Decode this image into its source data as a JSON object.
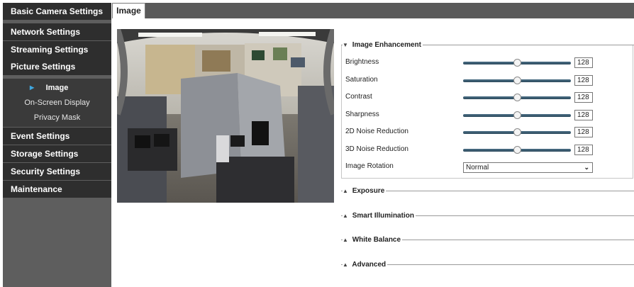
{
  "sidebar": {
    "items": [
      {
        "label": "Basic Camera Settings"
      },
      {
        "label": "Network Settings"
      },
      {
        "label": "Streaming Settings"
      },
      {
        "label": "Picture Settings"
      },
      {
        "label": "Event Settings"
      },
      {
        "label": "Storage Settings"
      },
      {
        "label": "Security Settings"
      },
      {
        "label": "Maintenance"
      }
    ],
    "subitems": [
      {
        "label": "Image"
      },
      {
        "label": "On-Screen Display"
      },
      {
        "label": "Privacy Mask"
      }
    ]
  },
  "tabs": {
    "active": "Image"
  },
  "image_enhancement": {
    "title": "Image Enhancement",
    "rows": [
      {
        "label": "Brightness",
        "value": "128",
        "level": 0.5
      },
      {
        "label": "Saturation",
        "value": "128",
        "level": 0.5
      },
      {
        "label": "Contrast",
        "value": "128",
        "level": 0.5
      },
      {
        "label": "Sharpness",
        "value": "128",
        "level": 0.5
      },
      {
        "label": "2D Noise Reduction",
        "value": "128",
        "level": 0.5
      },
      {
        "label": "3D Noise Reduction",
        "value": "128",
        "level": 0.5
      }
    ],
    "rotation": {
      "label": "Image Rotation",
      "value": "Normal"
    }
  },
  "sections": [
    {
      "title": "Exposure"
    },
    {
      "title": "Smart Illumination"
    },
    {
      "title": "White Balance"
    },
    {
      "title": "Advanced"
    }
  ],
  "icons": {
    "expanded": "caret-down-icon",
    "collapsed": "caret-up-icon",
    "active_sub": "triangle-right-icon",
    "select": "chevron-down-icon"
  },
  "colors": {
    "sidebar_header": "#2e2e2e",
    "sidebar_bg": "#5e5e5e",
    "accent_arrow": "#3fa7e0",
    "slider_track": "#3b5a6e"
  }
}
